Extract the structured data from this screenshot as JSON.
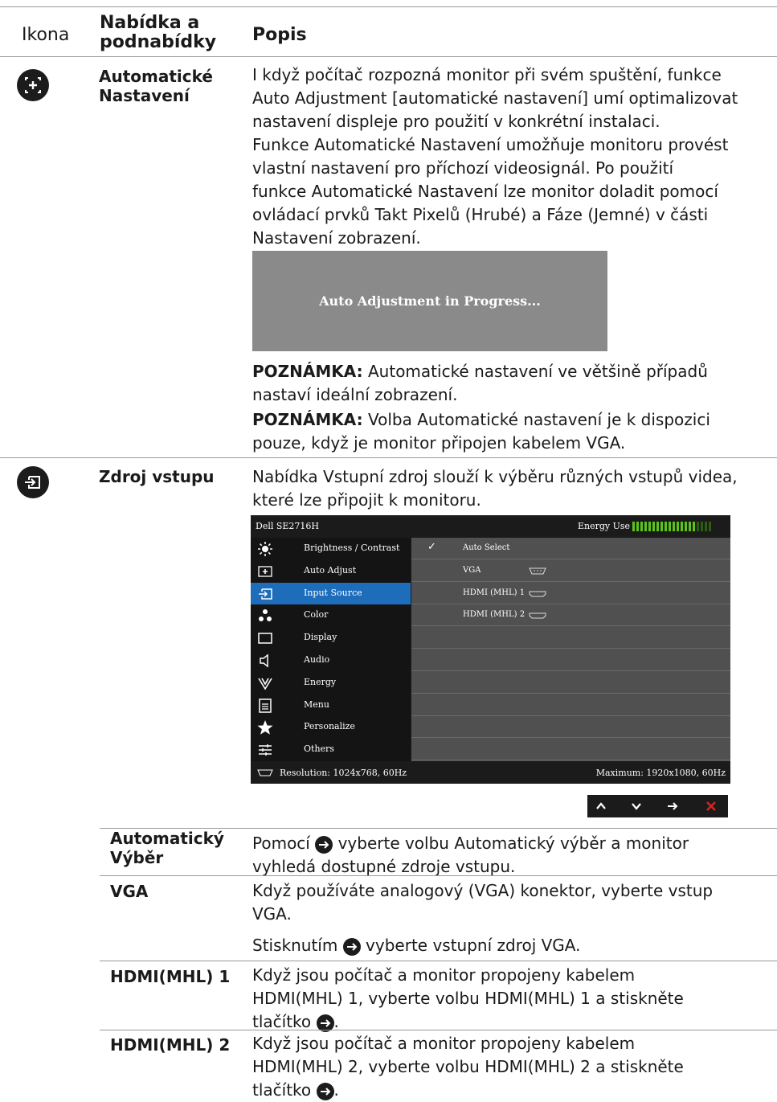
{
  "header": {
    "col1": "Ikona",
    "col2_line1": "Nabídka a",
    "col2_line2": "podnabídky",
    "col3": "Popis"
  },
  "auto_adjust": {
    "icon": "auto-adjust-icon",
    "name_line1": "Automatické",
    "name_line2": "Nastavení",
    "lines": [
      "I když počítač rozpozná monitor při svém spuštění, funkce",
      "Auto Adjustment [automatické nastavení] umí optimalizovat",
      "nastavení displeje pro použití v konkrétní instalaci.",
      "Funkce Automatické Nastavení umožňuje monitoru provést",
      "vlastní nastavení pro příchozí videosignál. Po použití",
      "funkce Automatické Nastavení lze monitor doladit pomocí",
      "ovládací prvků Takt Pixelů (Hrubé) a Fáze (Jemné) v části",
      "Nastavení zobrazení."
    ],
    "banner_text": "Auto Adjustment in Progress...",
    "note1_label": "POZNÁMKA:",
    "note1_line1": " Automatické nastavení ve většině případů",
    "note1_line2": "nastaví ideální zobrazení.",
    "note2_label": "POZNÁMKA:",
    "note2_line1": " Volba Automatické nastavení je k dispozici",
    "note2_line2": "pouze, když je monitor připojen kabelem VGA."
  },
  "input_source": {
    "icon": "input-source-icon",
    "name": "Zdroj vstupu",
    "line1": "Nabídka Vstupní zdroj slouží k výběru různých vstupů videa,",
    "line2": "které lze připojit k monitoru."
  },
  "osd": {
    "title": "Dell SE2716H",
    "energy_label": "Energy Use",
    "energy_level": 0.8,
    "menu": [
      {
        "label": "Brightness / Contrast",
        "icon": "brightness-icon",
        "selected": false
      },
      {
        "label": "Auto Adjust",
        "icon": "auto-adjust-icon",
        "selected": false
      },
      {
        "label": "Input Source",
        "icon": "input-source-icon",
        "selected": true
      },
      {
        "label": "Color",
        "icon": "color-icon",
        "selected": false
      },
      {
        "label": "Display",
        "icon": "display-icon",
        "selected": false
      },
      {
        "label": "Audio",
        "icon": "audio-icon",
        "selected": false
      },
      {
        "label": "Energy",
        "icon": "energy-icon",
        "selected": false
      },
      {
        "label": "Menu",
        "icon": "menu-icon",
        "selected": false
      },
      {
        "label": "Personalize",
        "icon": "star-icon",
        "selected": false
      },
      {
        "label": "Others",
        "icon": "others-icon",
        "selected": false
      }
    ],
    "options": [
      {
        "label": "Auto Select",
        "checked": true,
        "connector": ""
      },
      {
        "label": "VGA",
        "checked": false,
        "connector": "vga-connector-icon"
      },
      {
        "label": "HDMI (MHL) 1",
        "checked": false,
        "connector": "hdmi-connector-icon"
      },
      {
        "label": "HDMI (MHL) 2",
        "checked": false,
        "connector": "hdmi-connector-icon"
      }
    ],
    "resolution": "Resolution: 1024x768, 60Hz",
    "maximum": "Maximum: 1920x1080, 60Hz",
    "nav": [
      "up-arrow-icon",
      "down-arrow-icon",
      "right-arrow-icon",
      "close-icon"
    ],
    "colors": {
      "selected": "#1e6dbb",
      "energy_on": "#5ec21e",
      "energy_off": "#2e5c14",
      "close": "#e02020"
    }
  },
  "submenus": [
    {
      "name_line1": "Automatický",
      "name_line2": "Výběr",
      "lines": [
        {
          "pre": "Pomocí ",
          "btn": true,
          "post": " vyberte volbu Automatický výběr a monitor"
        },
        {
          "pre": "vyhledá dostupné zdroje vstupu.",
          "btn": false,
          "post": ""
        }
      ]
    },
    {
      "name_line1": "VGA",
      "lines": [
        {
          "pre": "Když používáte analogový (VGA) konektor, vyberte vstup",
          "btn": false,
          "post": ""
        },
        {
          "pre": "VGA.",
          "btn": false,
          "post": ""
        },
        {
          "pre": "Stisknutím ",
          "btn": true,
          "post": " vyberte vstupní zdroj VGA."
        }
      ]
    },
    {
      "name_line1": "HDMI(MHL) 1",
      "lines": [
        {
          "pre": "Když jsou počítač a monitor propojeny kabelem",
          "btn": false,
          "post": ""
        },
        {
          "pre": "HDMI(MHL) 1, vyberte volbu HDMI(MHL) 1 a stiskněte",
          "btn": false,
          "post": ""
        },
        {
          "pre": "tlačítko ",
          "btn": true,
          "post": "."
        }
      ]
    },
    {
      "name_line1": "HDMI(MHL) 2",
      "lines": [
        {
          "pre": "Když jsou počítač a monitor propojeny kabelem",
          "btn": false,
          "post": ""
        },
        {
          "pre": "HDMI(MHL) 2, vyberte volbu HDMI(MHL) 2 a stiskněte",
          "btn": false,
          "post": ""
        },
        {
          "pre": "tlačítko ",
          "btn": true,
          "post": "."
        }
      ]
    }
  ]
}
